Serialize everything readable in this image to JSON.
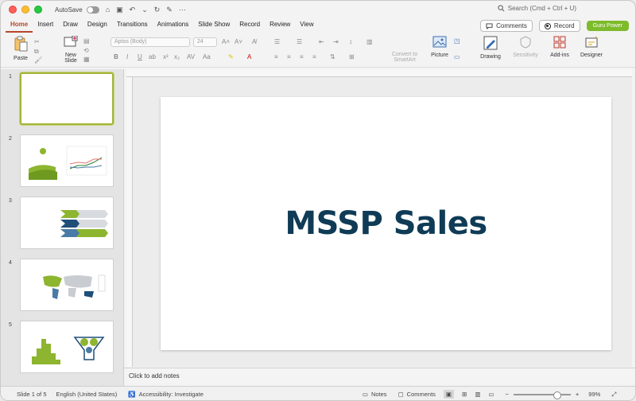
{
  "titlebar": {
    "autosave_label": "AutoSave",
    "search_placeholder": "Search (Cmd + Ctrl + U)"
  },
  "tabs": [
    "Home",
    "Insert",
    "Draw",
    "Design",
    "Transitions",
    "Animations",
    "Slide Show",
    "Record",
    "Review",
    "View"
  ],
  "active_tab": "Home",
  "header_buttons": {
    "comments": "Comments",
    "record": "Record",
    "guru": "Guru Power"
  },
  "ribbon": {
    "paste": "Paste",
    "new_slide_line1": "New",
    "new_slide_line2": "Slide",
    "font_name": "Aptos (Body)",
    "font_size": "24",
    "convert_line1": "Convert to",
    "convert_line2": "SmartArt",
    "picture": "Picture",
    "drawing": "Drawing",
    "sensitivity": "Sensitivity",
    "addins": "Add-ins",
    "designer": "Designer"
  },
  "slides": [
    {
      "num": "1"
    },
    {
      "num": "2"
    },
    {
      "num": "3"
    },
    {
      "num": "4"
    },
    {
      "num": "5"
    }
  ],
  "slide_title": "MSSP Sales",
  "notes_placeholder": "Click to add notes",
  "status": {
    "slide_info": "Slide 1 of 5",
    "language": "English (United States)",
    "accessibility": "Accessibility: Investigate",
    "notes": "Notes",
    "comments": "Comments",
    "zoom": "99%"
  },
  "colors": {
    "accent_tab": "#b7472a",
    "title_color": "#0f3b56",
    "green": "#8db52f",
    "guru_green": "#7dbb2a"
  }
}
